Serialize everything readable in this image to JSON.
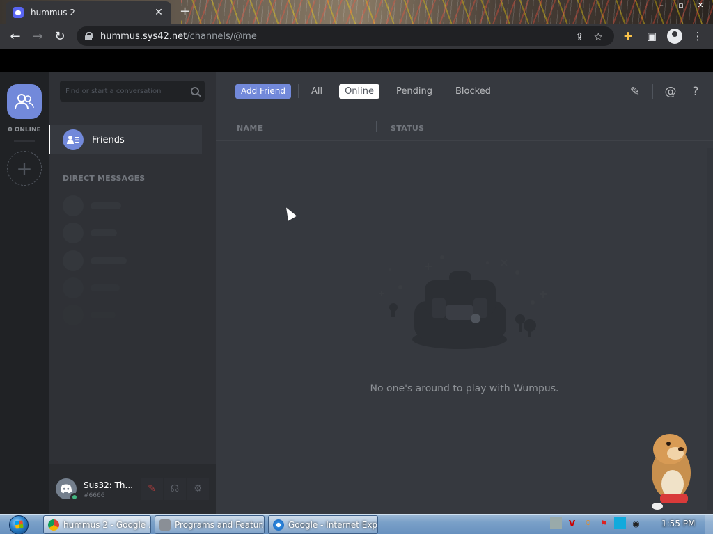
{
  "browser": {
    "tab_title": "hummus 2",
    "tab_close": "✕",
    "new_tab": "+",
    "url_host": "hummus.sys42.net",
    "url_path": "/channels/@me",
    "window_controls": {
      "minimize": "–",
      "maximize": "▫",
      "close": "✕"
    }
  },
  "guilds": {
    "online_count": "0 ONLINE",
    "add_server": "+"
  },
  "sidebar": {
    "search_placeholder": "Find or start a conversation",
    "friends_label": "Friends",
    "dm_header": "DIRECT MESSAGES"
  },
  "user": {
    "name": "Sus32: Th...",
    "tag": "#6666"
  },
  "header": {
    "add_friend": "Add Friend",
    "tabs": [
      "All",
      "Online",
      "Pending",
      "Blocked"
    ],
    "active_tab": "Online"
  },
  "columns": {
    "name": "NAME",
    "status": "STATUS"
  },
  "empty_state": "No one's around to play with Wumpus.",
  "taskbar": {
    "windows": [
      {
        "label": "hummus 2 - Google ...",
        "icon": "chrome-icon"
      },
      {
        "label": "Programs and Featur...",
        "icon": "programs-icon"
      },
      {
        "label": "Google - Internet Exp...",
        "icon": "ie-icon"
      }
    ],
    "clock": "1:55 PM"
  },
  "colors": {
    "blurple": "#7289da",
    "bg_main": "#36393f",
    "bg_sidebar": "#2f3136",
    "bg_guilds": "#202225"
  }
}
